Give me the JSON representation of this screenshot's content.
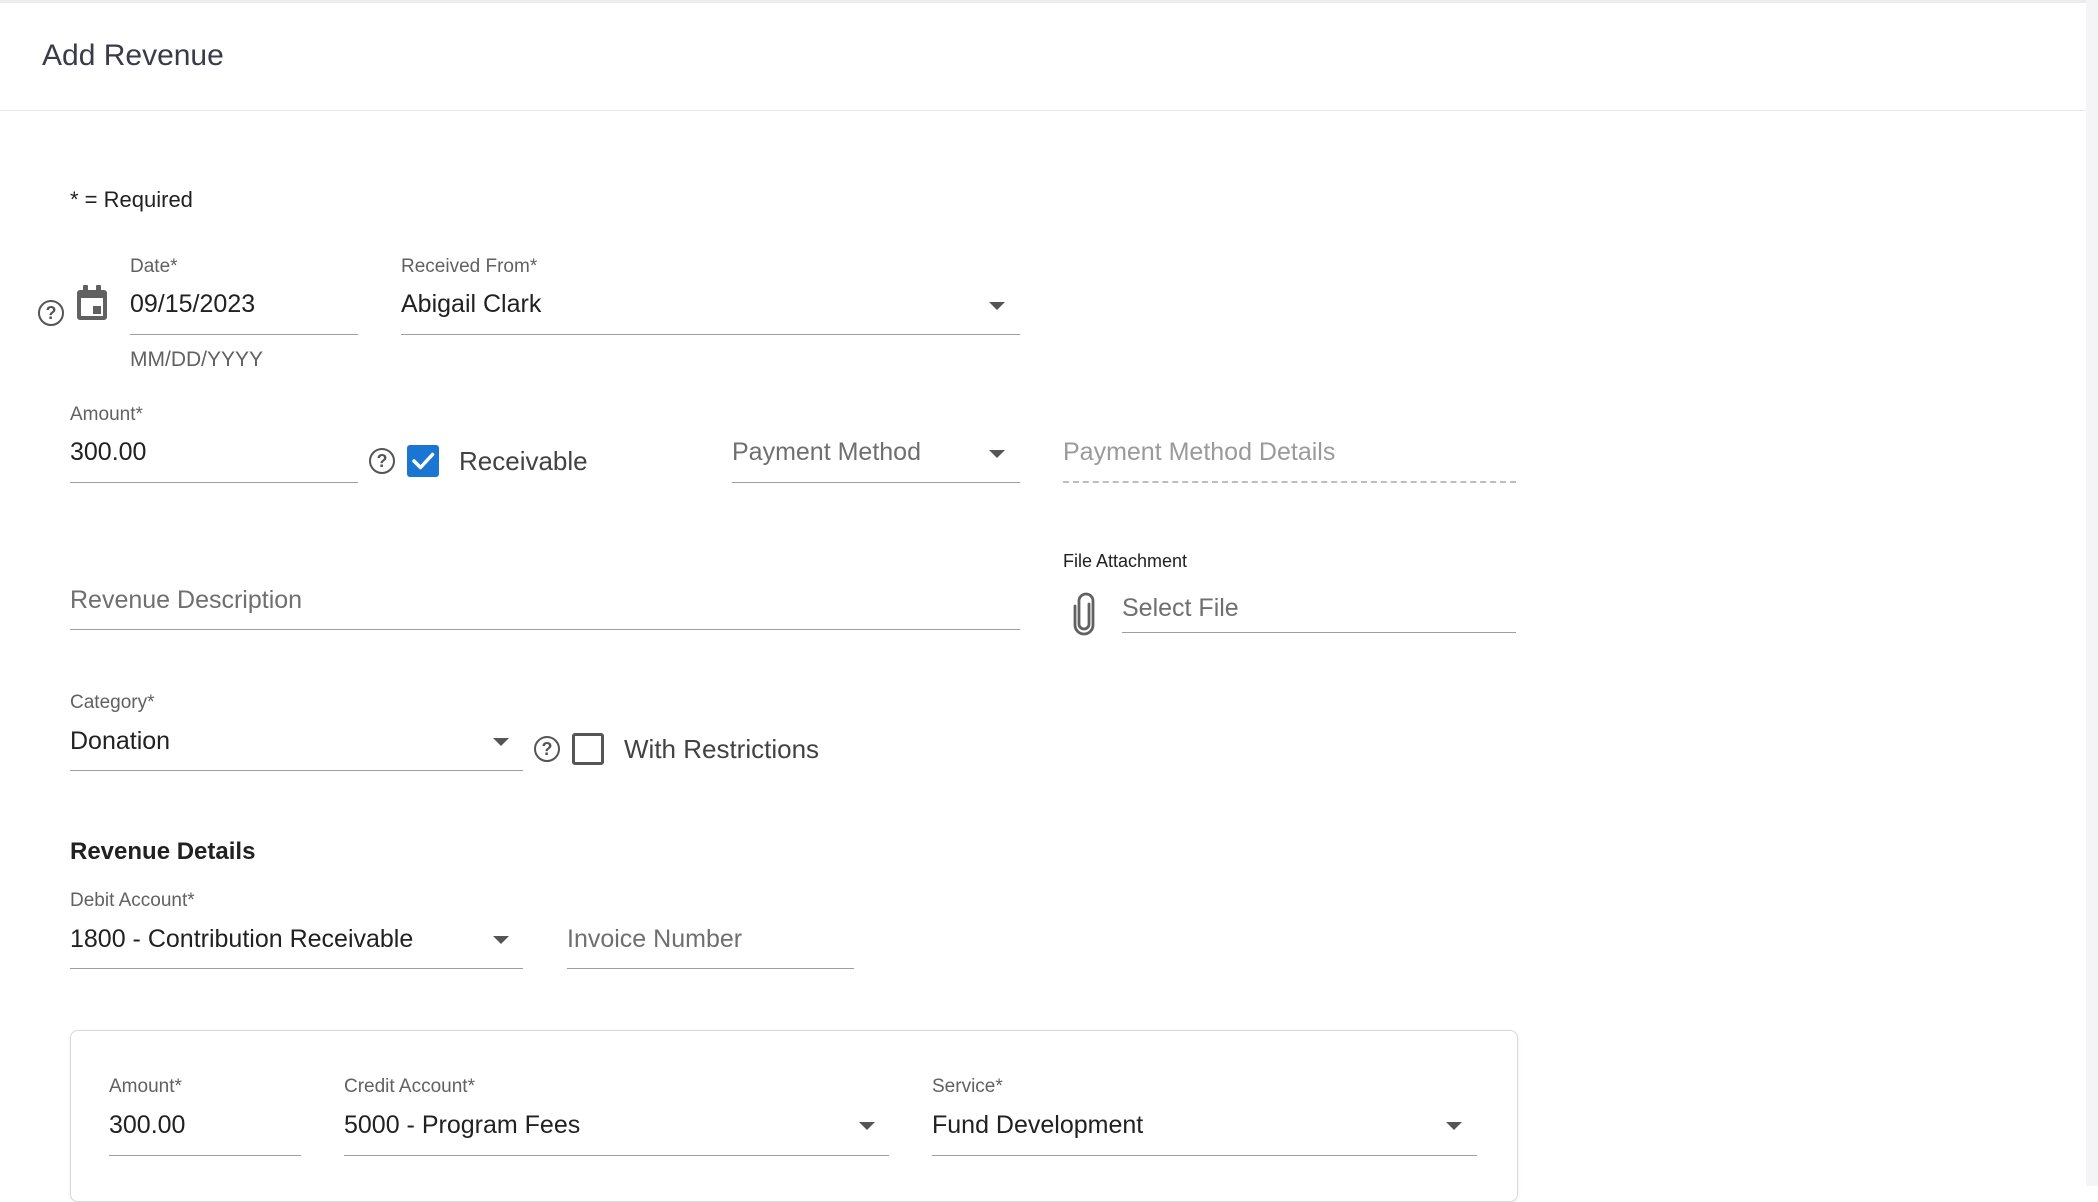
{
  "header": {
    "title": "Add Revenue"
  },
  "form": {
    "required_note": "* = Required",
    "date": {
      "label": "Date*",
      "value": "09/15/2023",
      "helper": "MM/DD/YYYY"
    },
    "received_from": {
      "label": "Received From*",
      "value": "Abigail Clark"
    },
    "amount": {
      "label": "Amount*",
      "value": "300.00"
    },
    "receivable": {
      "label": "Receivable",
      "checked": true
    },
    "payment_method": {
      "placeholder": "Payment Method"
    },
    "payment_method_details": {
      "placeholder": "Payment Method Details"
    },
    "revenue_description": {
      "placeholder": "Revenue Description"
    },
    "file_attachment": {
      "label": "File Attachment",
      "placeholder": "Select File"
    },
    "category": {
      "label": "Category*",
      "value": "Donation"
    },
    "with_restrictions": {
      "label": "With Restrictions",
      "checked": false
    }
  },
  "revenue_details": {
    "title": "Revenue Details",
    "debit_account": {
      "label": "Debit Account*",
      "value": "1800 - Contribution Receivable"
    },
    "invoice_number": {
      "placeholder": "Invoice Number"
    },
    "line": {
      "amount": {
        "label": "Amount*",
        "value": "300.00"
      },
      "credit_account": {
        "label": "Credit Account*",
        "value": "5000 - Program Fees"
      },
      "service": {
        "label": "Service*",
        "value": "Fund Development"
      }
    }
  },
  "colors": {
    "accent": "#1976d2",
    "text": "#212121",
    "label": "#616161"
  }
}
